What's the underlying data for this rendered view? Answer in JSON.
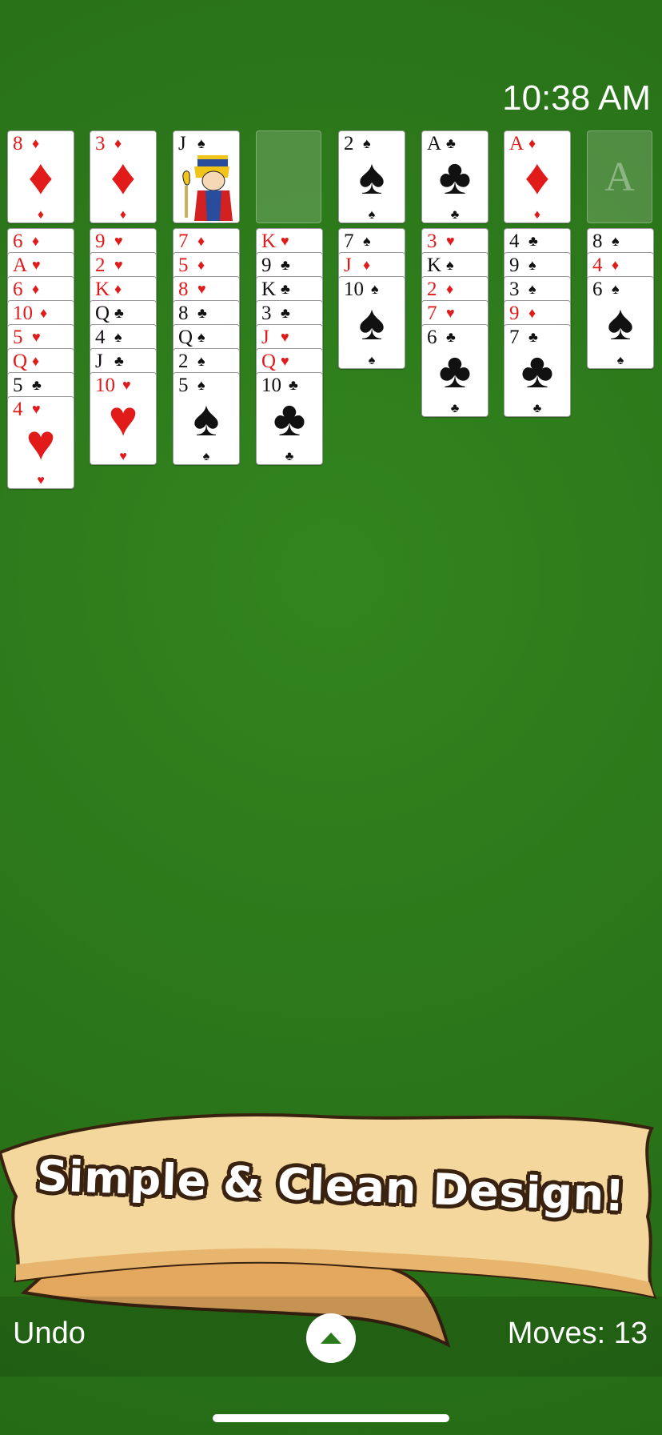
{
  "status_bar": {
    "time": "10:38 AM"
  },
  "colors": {
    "felt": "#2c7a1c",
    "red_suit": "#e11a1a",
    "black_suit": "#111111",
    "banner": "#f2cf8e"
  },
  "free_cells": [
    {
      "rank": "8",
      "suit": "diamond"
    },
    {
      "rank": "3",
      "suit": "diamond"
    },
    {
      "rank": "J",
      "suit": "spade",
      "face_art": true
    },
    null
  ],
  "foundations": [
    {
      "rank": "2",
      "suit": "spade"
    },
    {
      "rank": "A",
      "suit": "club"
    },
    {
      "rank": "A",
      "suit": "diamond"
    },
    {
      "empty_label": "A"
    }
  ],
  "tableau": [
    [
      {
        "rank": "6",
        "suit": "diamond"
      },
      {
        "rank": "A",
        "suit": "heart"
      },
      {
        "rank": "6",
        "suit": "diamond"
      },
      {
        "rank": "10",
        "suit": "diamond"
      },
      {
        "rank": "5",
        "suit": "heart"
      },
      {
        "rank": "Q",
        "suit": "diamond"
      },
      {
        "rank": "5",
        "suit": "club"
      },
      {
        "rank": "4",
        "suit": "heart"
      }
    ],
    [
      {
        "rank": "9",
        "suit": "heart"
      },
      {
        "rank": "2",
        "suit": "heart"
      },
      {
        "rank": "K",
        "suit": "diamond"
      },
      {
        "rank": "Q",
        "suit": "club"
      },
      {
        "rank": "4",
        "suit": "spade"
      },
      {
        "rank": "J",
        "suit": "club"
      },
      {
        "rank": "10",
        "suit": "heart"
      }
    ],
    [
      {
        "rank": "7",
        "suit": "diamond"
      },
      {
        "rank": "5",
        "suit": "diamond"
      },
      {
        "rank": "8",
        "suit": "heart"
      },
      {
        "rank": "8",
        "suit": "club"
      },
      {
        "rank": "Q",
        "suit": "spade"
      },
      {
        "rank": "2",
        "suit": "spade"
      },
      {
        "rank": "5",
        "suit": "spade"
      }
    ],
    [
      {
        "rank": "K",
        "suit": "heart"
      },
      {
        "rank": "9",
        "suit": "club"
      },
      {
        "rank": "K",
        "suit": "club"
      },
      {
        "rank": "3",
        "suit": "club"
      },
      {
        "rank": "J",
        "suit": "heart"
      },
      {
        "rank": "Q",
        "suit": "heart"
      },
      {
        "rank": "10",
        "suit": "club"
      }
    ],
    [
      {
        "rank": "7",
        "suit": "spade"
      },
      {
        "rank": "J",
        "suit": "diamond"
      },
      {
        "rank": "10",
        "suit": "spade"
      }
    ],
    [
      {
        "rank": "3",
        "suit": "heart"
      },
      {
        "rank": "K",
        "suit": "spade"
      },
      {
        "rank": "2",
        "suit": "diamond"
      },
      {
        "rank": "7",
        "suit": "heart"
      },
      {
        "rank": "6",
        "suit": "club"
      }
    ],
    [
      {
        "rank": "4",
        "suit": "club"
      },
      {
        "rank": "9",
        "suit": "spade"
      },
      {
        "rank": "3",
        "suit": "spade"
      },
      {
        "rank": "9",
        "suit": "diamond"
      },
      {
        "rank": "7",
        "suit": "club"
      }
    ],
    [
      {
        "rank": "8",
        "suit": "spade"
      },
      {
        "rank": "4",
        "suit": "diamond"
      },
      {
        "rank": "6",
        "suit": "spade"
      }
    ]
  ],
  "banner": {
    "text": "Simple & Clean Design!"
  },
  "bottom_bar": {
    "undo_label": "Undo",
    "moves_label": "Moves: 13",
    "menu_icon": "triangle-up-icon"
  }
}
